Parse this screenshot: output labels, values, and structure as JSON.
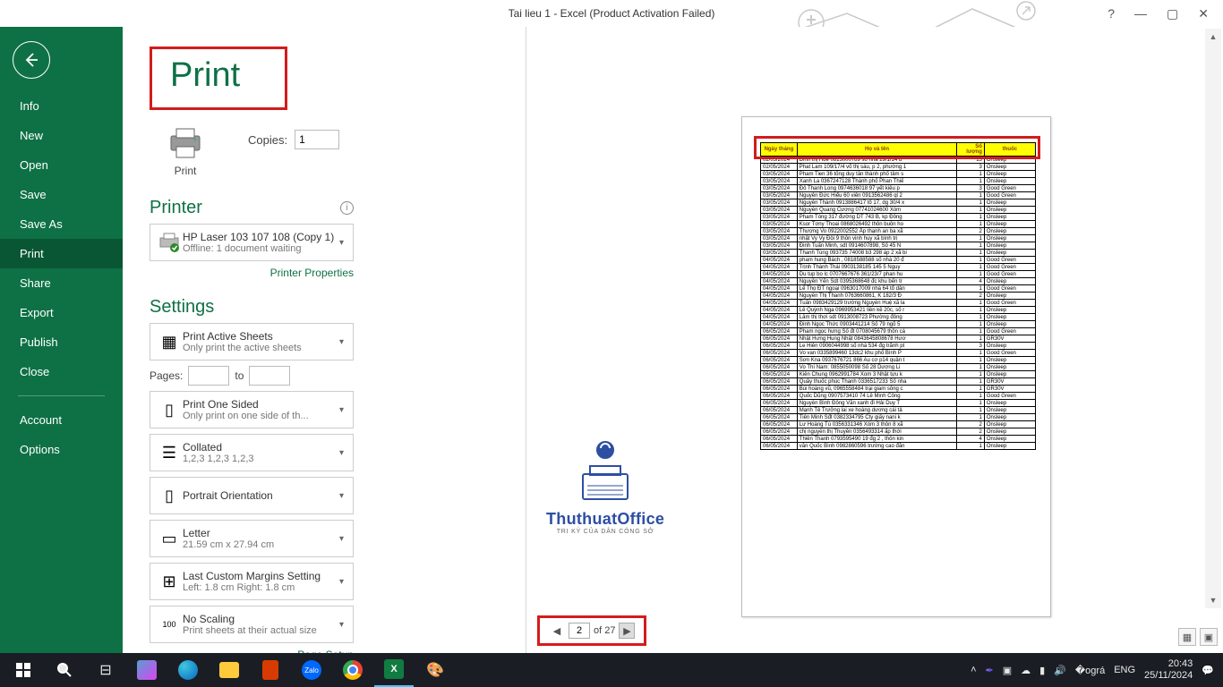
{
  "titlebar": {
    "title": "Tai lieu 1 - Excel (Product Activation Failed)"
  },
  "sidebar": {
    "items": [
      "Info",
      "New",
      "Open",
      "Save",
      "Save As",
      "Print",
      "Share",
      "Export",
      "Publish",
      "Close"
    ],
    "bottom": [
      "Account",
      "Options"
    ],
    "active": "Print"
  },
  "heading": "Print",
  "printbtn": "Print",
  "copies": {
    "label": "Copies:",
    "value": "1"
  },
  "printer": {
    "section": "Printer",
    "name": "HP Laser 103 107 108 (Copy 1)",
    "status": "Offline: 1 document waiting",
    "props_link": "Printer Properties"
  },
  "settings": {
    "section": "Settings",
    "pages_label": "Pages:",
    "pages_to": "to",
    "active_sheets": {
      "t1": "Print Active Sheets",
      "t2": "Only print the active sheets"
    },
    "sided": {
      "t1": "Print One Sided",
      "t2": "Only print on one side of th..."
    },
    "collated": {
      "t1": "Collated",
      "t2": "1,2,3    1,2,3    1,2,3"
    },
    "orientation": {
      "t1": "Portrait Orientation",
      "t2": ""
    },
    "paper": {
      "t1": "Letter",
      "t2": "21.59 cm x 27.94 cm"
    },
    "margins": {
      "t1": "Last Custom Margins Setting",
      "t2": "Left:  1.8 cm    Right:  1.8 cm"
    },
    "scaling": {
      "t1": "No Scaling",
      "t2": "Print sheets at their actual size"
    },
    "page_setup": "Page Setup"
  },
  "pager": {
    "current": "2",
    "of_label": "of 27"
  },
  "watermark": {
    "big": "ThuthuatOffice",
    "small": "TRI KỶ CỦA DÂN CÔNG SỞ"
  },
  "preview_table": {
    "headers": [
      "Ngày tháng",
      "Họ và tên",
      "Số lượng",
      "thuốc"
    ],
    "rows": [
      [
        "02/05/2024",
        "Đinh thị Huế 0813000789 số nhà 29/1/14 đ",
        "13",
        "Onsleep"
      ],
      [
        "02/05/2024",
        "Phat Lam 109/17/4 võ thị sáu, p 2, phường 1",
        "3",
        "Onsleep"
      ],
      [
        "03/05/2024",
        "Pham Tien 36 tống duy tân thành phố tâm s",
        "1",
        "Onsleep"
      ],
      [
        "03/05/2024",
        "Xanh La 0367247128 Thành phố Phan Thiế",
        "1",
        "Onsleep"
      ],
      [
        "03/05/2024",
        "Đô Thanh Long 0974636018  97 yết kiêu p",
        "3",
        "Good Green"
      ],
      [
        "03/05/2024",
        "Nguyên Đức Hiểu 60 viên 0913562486 ql 2",
        "1",
        "Good Green"
      ],
      [
        "03/05/2024",
        "Nguyên Thành 0913886417 tổ 17, dg 30/4 x",
        "1",
        "Onsleep"
      ],
      [
        "03/05/2024",
        "Nguyễn Quang Cương 07741024600 Xóm",
        "1",
        "Onsleep"
      ],
      [
        "03/05/2024",
        "Pham Tòng 317 đường DT  743 B, kp Đông",
        "1",
        "Onsleep"
      ],
      [
        "03/05/2024",
        "Ksor Tơny Thoai 0868026492 thôn buôn ho",
        "1",
        "Onsleep"
      ],
      [
        "03/05/2024",
        "Thượng Vo 0922002552 Ấp thạnh an ba xã",
        "2",
        "Onsleep"
      ],
      [
        "03/05/2024",
        "nhật Vy Vy Đội 9 thôn vinh huy xã bình trị",
        "1",
        "Onsleep"
      ],
      [
        "03/05/2024",
        "Đinh Tuấn Minh, sdt 0914607898, Số 45 N",
        "1",
        "Onsleep"
      ],
      [
        "03/05/2024",
        "Thanh Tùng 093735 74008 b3 298 áp 2 xã bi",
        "1",
        "Onsleep"
      ],
      [
        "04/05/2024",
        "pham hung Bách , 0818588588 số nhà 20 đ",
        "1",
        "Good Green"
      ],
      [
        "04/05/2024",
        "Trịnh Thành Thái 0903138185 145 5 Nguy",
        "1",
        "Good Green"
      ],
      [
        "04/05/2024",
        "Du tup bo lc 0707667676 361/23/7 phan hu",
        "1",
        "Good Green"
      ],
      [
        "04/05/2024",
        "Nguyên Yến Sdt 0395368648 đc khu bến tr",
        "4",
        "Onsleep"
      ],
      [
        "04/05/2024",
        "Lế Thọ ĐT ngoại 0963017009 nhà 64 tổ dân",
        "1",
        "Good Green"
      ],
      [
        "04/05/2024",
        "Nguyễn Thị Thanh 0763660861, K 182/3 Đ",
        "2",
        "Onsleep"
      ],
      [
        "04/05/2024",
        "Tuấn 0983429129 trường Nguyễn Huệ xã la",
        "1",
        "Good Green"
      ],
      [
        "04/05/2024",
        "Lê Quỳnh Nga 0969953421 liền kề 20c, số r",
        "1",
        "Onsleep"
      ],
      [
        "04/05/2024",
        "Lâm  thị thơi sdt 0913008723 Phường đông",
        "1",
        "Onsleep"
      ],
      [
        "04/05/2024",
        "Đinh Ngọc Thức 0903441214  Số 79 ngõ 5",
        "1",
        "Onsleep"
      ],
      [
        "06/05/2024",
        "Pham  ngọc hưng Số đt 0708045679 thôn cá",
        "1",
        "Good Green"
      ],
      [
        "06/05/2024",
        "Nhật Hưng Hung Nhật 0843645808678 Hươ",
        "1",
        "GR30V"
      ],
      [
        "06/05/2024",
        "Le Hiên 0906044998 số nhà 534 đg trãnh pt",
        "3",
        "Onsleep"
      ],
      [
        "06/05/2024",
        "Vo van 0335899460 13dc2 khu phố Bình P",
        "1",
        "Good Green"
      ],
      [
        "06/05/2024",
        "Sơn Kna 0937676721 866 Au cơ p14 quận t",
        "1",
        "Onsleep"
      ],
      [
        "06/05/2024",
        "Vo Thí Nam: 0855050098 Số 28  Dương Li",
        "1",
        "Onsleep"
      ],
      [
        "06/05/2024",
        "Kiên Chung 0962991784 Xom 3 Nhật tựu k",
        "1",
        "Onsleep"
      ],
      [
        "06/05/2024",
        "Quây thuốc phúc Thanh 0336517233 Số nha",
        "1",
        "GR30V"
      ],
      [
        "06/05/2024",
        "Bùi hoàng vũ, 0965558484 trại giam sông c",
        "1",
        "GR30V"
      ],
      [
        "06/05/2024",
        "Quốc Dũng 0907573410 74 Lê Minh Công",
        "1",
        "Good Green"
      ],
      [
        "06/05/2024",
        "Nguyễn Bình Đông Văn xanh đi Hải Duy T",
        "1",
        "Onsleep"
      ],
      [
        "06/05/2024",
        "Mạnh Tê Trưởng lai xe hoàng dương cái tả",
        "1",
        "Onsleep"
      ],
      [
        "06/05/2024",
        "Tiên Minh Sđt 0382334795 Cty giấy nani k",
        "1",
        "Onsleep"
      ],
      [
        "06/05/2024",
        "Lư Hoàng Tú 0356331346 Xóm 3 thôn 8 xã",
        "2",
        "Onsleep"
      ],
      [
        "06/05/2024",
        "chị nguyễn thị Thuyên 0356493314 ấp thới",
        "2",
        "Onsleep"
      ],
      [
        "06/05/2024",
        "Thiên Thanh 0793595490 19 đg 2 , thôn kin",
        "4",
        "Onsleep"
      ],
      [
        "06/05/2024",
        "văn Quốc Bình 0982860596 trường cao đẳn",
        "1",
        "Onsleep"
      ]
    ]
  },
  "taskbar": {
    "lang": "ENG",
    "time": "20:43",
    "date": "25/11/2024"
  }
}
